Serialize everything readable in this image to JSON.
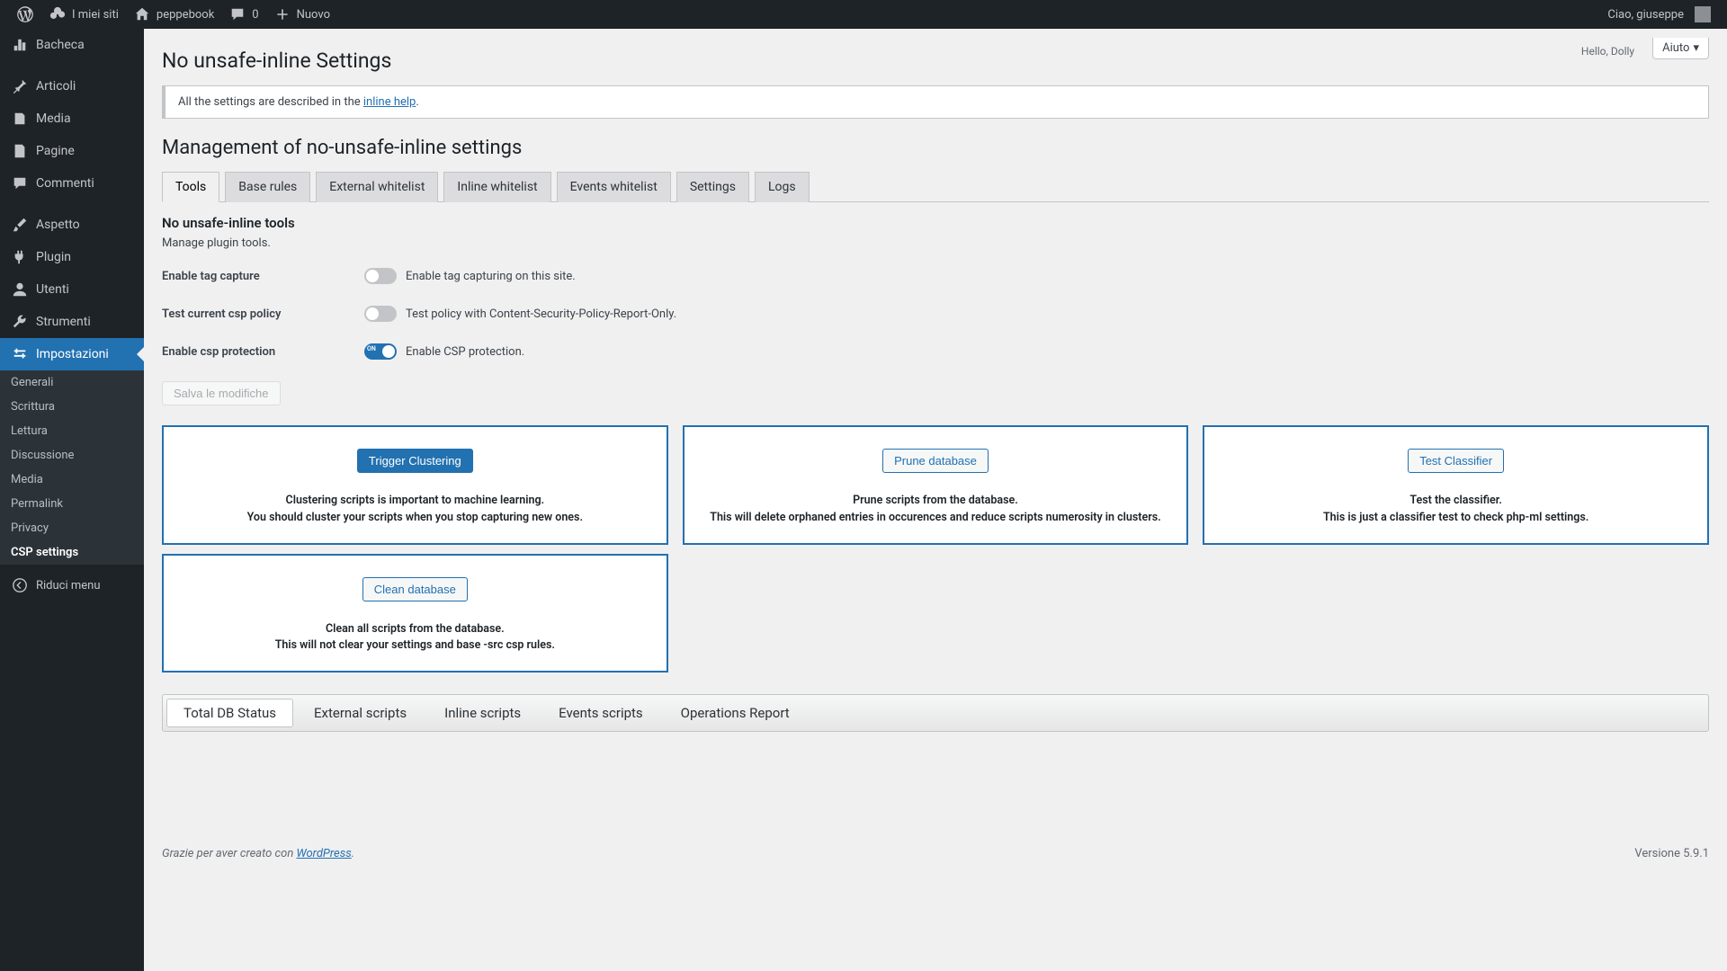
{
  "adminbar": {
    "my_sites": "I miei siti",
    "site_name": "peppebook",
    "comments_count": "0",
    "new": "Nuovo",
    "greeting": "Ciao, giuseppe"
  },
  "sidebar": {
    "items": [
      {
        "label": "Bacheca"
      },
      {
        "label": "Articoli"
      },
      {
        "label": "Media"
      },
      {
        "label": "Pagine"
      },
      {
        "label": "Commenti"
      },
      {
        "label": "Aspetto"
      },
      {
        "label": "Plugin"
      },
      {
        "label": "Utenti"
      },
      {
        "label": "Strumenti"
      },
      {
        "label": "Impostazioni"
      }
    ],
    "submenu": [
      {
        "label": "Generali"
      },
      {
        "label": "Scrittura"
      },
      {
        "label": "Lettura"
      },
      {
        "label": "Discussione"
      },
      {
        "label": "Media"
      },
      {
        "label": "Permalink"
      },
      {
        "label": "Privacy"
      },
      {
        "label": "CSP settings"
      }
    ],
    "collapse": "Riduci menu"
  },
  "header": {
    "hello_dolly": "Hello, Dolly",
    "help": "Aiuto",
    "page_title": "No unsafe-inline Settings"
  },
  "notice": {
    "prefix": "All the settings are described in the ",
    "link": "inline help",
    "suffix": "."
  },
  "main": {
    "heading": "Management of no-unsafe-inline settings",
    "tabs": [
      "Tools",
      "Base rules",
      "External whitelist",
      "Inline whitelist",
      "Events whitelist",
      "Settings",
      "Logs"
    ],
    "tools_heading": "No unsafe-inline tools",
    "tools_desc": "Manage plugin tools.",
    "rows": [
      {
        "label": "Enable tag capture",
        "desc": "Enable tag capturing on this site.",
        "on": false
      },
      {
        "label": "Test current csp policy",
        "desc": "Test policy with Content-Security-Policy-Report-Only.",
        "on": false
      },
      {
        "label": "Enable csp protection",
        "desc": "Enable CSP protection.",
        "on": true
      }
    ],
    "save": "Salva le modifiche",
    "cards": [
      {
        "btn": "Trigger Clustering",
        "primary": true,
        "line1": "Clustering scripts is important to machine learning.",
        "line2": "You should cluster your scripts when you stop capturing new ones."
      },
      {
        "btn": "Prune database",
        "primary": false,
        "line1": "Prune scripts from the database.",
        "line2": "This will delete orphaned entries in occurences and reduce scripts numerosity in clusters."
      },
      {
        "btn": "Test Classifier",
        "primary": false,
        "line1": "Test the classifier.",
        "line2": "This is just a classifier test to check php-ml settings."
      },
      {
        "btn": "Clean database",
        "primary": false,
        "line1": "Clean all scripts from the database.",
        "line2": "This will not clear your settings and base -src csp rules."
      }
    ],
    "db_tabs": [
      "Total DB Status",
      "External scripts",
      "Inline scripts",
      "Events scripts",
      "Operations Report"
    ]
  },
  "footer": {
    "thanks_prefix": "Grazie per aver creato con ",
    "thanks_link": "WordPress",
    "thanks_suffix": ".",
    "version": "Versione 5.9.1"
  }
}
